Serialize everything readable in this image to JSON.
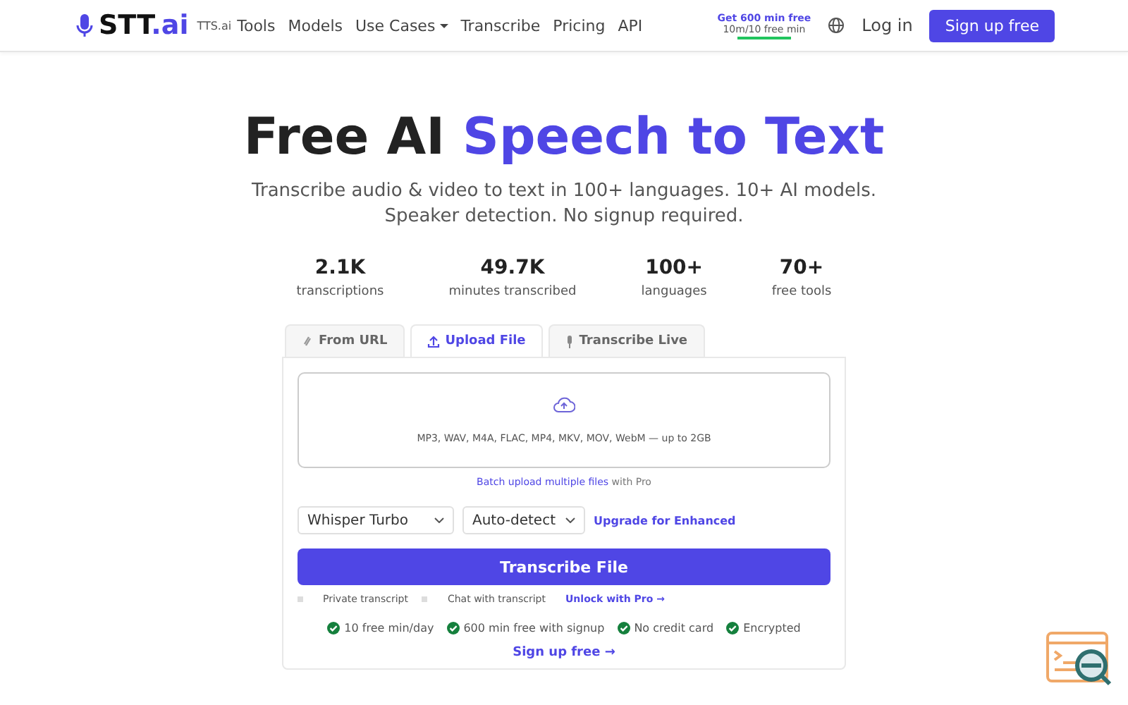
{
  "nav": {
    "logo_main": "STT",
    "logo_accent": ".ai",
    "sister_link": "TTS.ai",
    "links": [
      {
        "label": "Tools",
        "dropdown": false
      },
      {
        "label": "Models",
        "dropdown": false
      },
      {
        "label": "Use Cases",
        "dropdown": true
      },
      {
        "label": "Transcribe",
        "dropdown": false
      },
      {
        "label": "Pricing",
        "dropdown": false
      },
      {
        "label": "API",
        "dropdown": false
      }
    ],
    "promo": {
      "title": "Get 600 min free",
      "usage": "10m/10 free min"
    },
    "login": "Log in",
    "signup": "Sign up free"
  },
  "hero": {
    "title_plain": "Free AI ",
    "title_accent": "Speech to Text",
    "subtitle": "Transcribe audio & video to text in 100+ languages. 10+ AI models. Speaker detection. No signup required."
  },
  "stats": [
    {
      "value": "2.1K",
      "label": "transcriptions"
    },
    {
      "value": "49.7K",
      "label": "minutes transcribed"
    },
    {
      "value": "100+",
      "label": "languages"
    },
    {
      "value": "70+",
      "label": "free tools"
    }
  ],
  "tabs": [
    {
      "label": "From URL",
      "selected": false
    },
    {
      "label": "Upload File",
      "selected": true
    },
    {
      "label": "Transcribe Live",
      "selected": false
    }
  ],
  "dropzone": {
    "formats": "MP3, WAV, M4A, FLAC, MP4, MKV, MOV, WebM — up to 2GB",
    "batch_link": "Batch upload multiple files",
    "batch_suffix": " with Pro"
  },
  "selects": [
    {
      "value": "Whisper Turbo"
    },
    {
      "value": "Auto-detect"
    }
  ],
  "upgrade_link": "Upgrade for Enhanced",
  "submit": "Transcribe File",
  "options": [
    {
      "label": "Private transcript",
      "checked": false
    },
    {
      "label": "Chat with transcript",
      "checked": false
    }
  ],
  "unlock_link": "Unlock with Pro →",
  "features": [
    "10 free min/day",
    "600 min free with signup",
    "No credit card",
    "Encrypted"
  ],
  "signup_link": "Sign up free →"
}
